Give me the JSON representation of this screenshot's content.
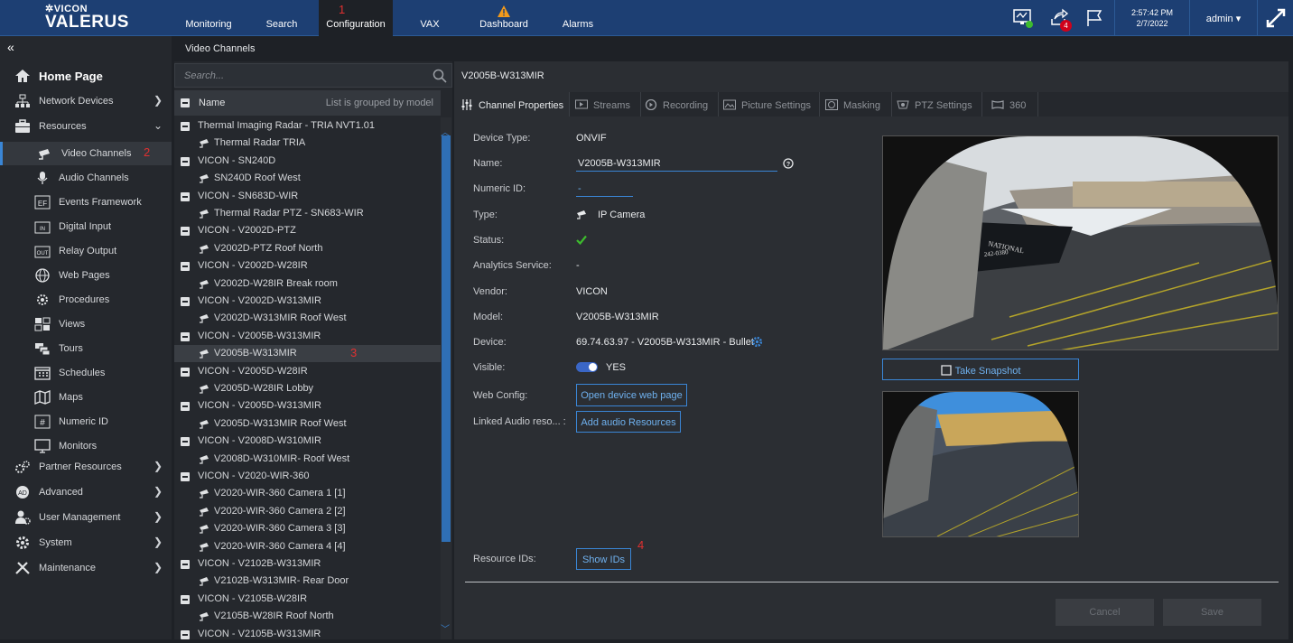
{
  "header": {
    "logo_small": "VICON",
    "logo_big": "VALERUS",
    "nav": [
      "Monitoring",
      "Search",
      "Configuration",
      "VAX",
      "Dashboard",
      "Alarms"
    ],
    "markers": [
      "1",
      "2",
      "3",
      "4"
    ],
    "notifications_badge": "4",
    "time": "2:57:42 PM",
    "date": "2/7/2022",
    "user": "admin ▾",
    "colors": {
      "topbar": "#1d3f73",
      "accent": "#3a86d6",
      "badge": "#d0021b",
      "warning": "#f29a1b",
      "status_ok": "#3dbb2e"
    }
  },
  "sidebar": {
    "home": "Home Page",
    "items": [
      "Network Devices",
      "Resources"
    ],
    "resources": [
      "Video Channels",
      "Audio Channels",
      "Events Framework",
      "Digital Input",
      "Relay Output",
      "Web Pages",
      "Procedures",
      "Views",
      "Tours",
      "Schedules",
      "Maps",
      "Numeric ID",
      "Monitors"
    ],
    "more": [
      "Partner Resources",
      "Advanced",
      "User Management",
      "System",
      "Maintenance"
    ]
  },
  "breadcrumb": "Video Channels",
  "tree": {
    "search_placeholder": "Search...",
    "col_name": "Name",
    "grouping": "List is grouped by model",
    "rows": [
      {
        "label": "Thermal Imaging Radar - TRIA NVT1.01",
        "group": true
      },
      {
        "label": "Thermal Radar TRIA",
        "group": false
      },
      {
        "label": "VICON - SN240D",
        "group": true
      },
      {
        "label": "SN240D Roof West",
        "group": false
      },
      {
        "label": "VICON - SN683D-WIR",
        "group": true
      },
      {
        "label": "Thermal Radar PTZ - SN683-WIR",
        "group": false
      },
      {
        "label": "VICON - V2002D-PTZ",
        "group": true
      },
      {
        "label": "V2002D-PTZ Roof North",
        "group": false
      },
      {
        "label": "VICON - V2002D-W28IR",
        "group": true
      },
      {
        "label": "V2002D-W28IR Break room",
        "group": false
      },
      {
        "label": "VICON - V2002D-W313MIR",
        "group": true
      },
      {
        "label": "V2002D-W313MIR Roof West",
        "group": false
      },
      {
        "label": "VICON - V2005B-W313MIR",
        "group": true
      },
      {
        "label": "V2005B-W313MIR",
        "group": false
      },
      {
        "label": "VICON - V2005D-W28IR",
        "group": true
      },
      {
        "label": "V2005D-W28IR Lobby",
        "group": false
      },
      {
        "label": "VICON - V2005D-W313MIR",
        "group": true
      },
      {
        "label": "V2005D-W313MIR Roof West",
        "group": false
      },
      {
        "label": "VICON - V2008D-W310MIR",
        "group": true
      },
      {
        "label": "V2008D-W310MIR- Roof West",
        "group": false
      },
      {
        "label": "VICON - V2020-WIR-360",
        "group": true
      },
      {
        "label": "V2020-WIR-360 Camera 1 [1]",
        "group": false
      },
      {
        "label": "V2020-WIR-360 Camera 2 [2]",
        "group": false
      },
      {
        "label": "V2020-WIR-360 Camera 3 [3]",
        "group": false
      },
      {
        "label": "V2020-WIR-360 Camera 4 [4]",
        "group": false
      },
      {
        "label": "VICON - V2102B-W313MIR",
        "group": true
      },
      {
        "label": "V2102B-W313MIR- Rear Door",
        "group": false
      },
      {
        "label": "VICON - V2105B-W28IR",
        "group": true
      },
      {
        "label": "V2105B-W28IR Roof North",
        "group": false
      },
      {
        "label": "VICON - V2105B-W313MIR",
        "group": true
      }
    ]
  },
  "detail": {
    "title": "V2005B-W313MIR",
    "tabs": [
      "Channel Properties",
      "Streams",
      "Recording",
      "Picture Settings",
      "Masking",
      "PTZ Settings",
      "360"
    ],
    "labels": [
      "Device Type:",
      "Name:",
      "Numeric ID:",
      "Type:",
      "Status:",
      "Analytics Service:",
      "Vendor:",
      "Model:",
      "Device:",
      "Visible:",
      "Web Config:",
      "Linked Audio reso... :",
      "Resource IDs:"
    ],
    "device_type": "ONVIF",
    "name": "V2005B-W313MIR",
    "numeric_id": "-",
    "type": "IP Camera",
    "analytics": "-",
    "vendor": "VICON",
    "model": "V2005B-W313MIR",
    "device": "69.74.63.97 - V2005B-W313MIR - Bullet",
    "visible": "YES",
    "open_web": "Open device web page",
    "add_audio": "Add audio Resources",
    "show_ids": "Show IDs",
    "take_snapshot": "Take Snapshot",
    "preview_text": "NATIONAL",
    "preview_text2": "242-0380",
    "cancel": "Cancel",
    "save": "Save"
  }
}
